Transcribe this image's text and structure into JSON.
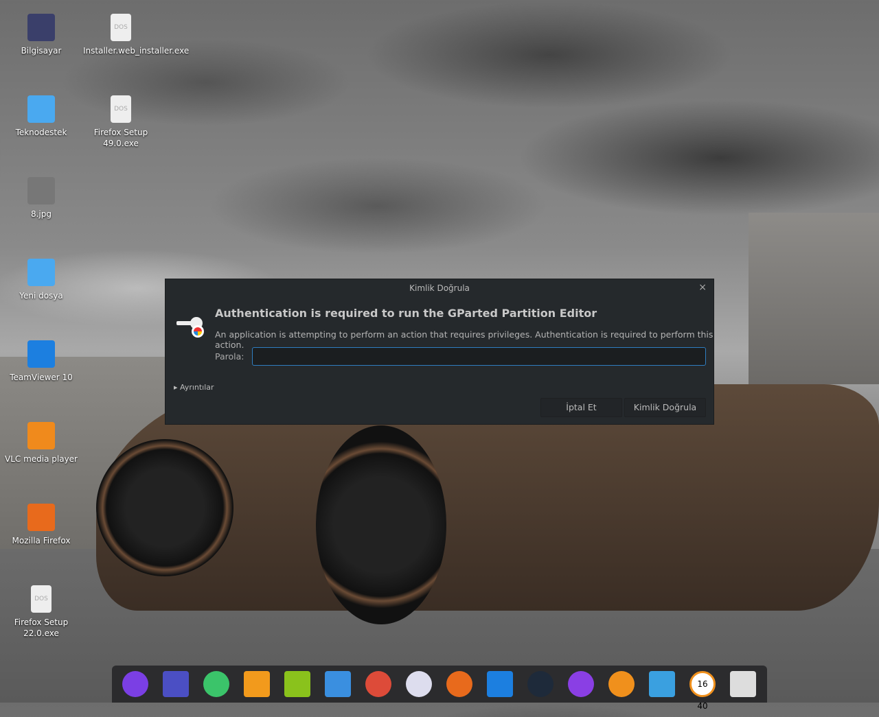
{
  "desktop_icons": [
    {
      "label": "Bilgisayar",
      "color": "#3a3f6a"
    },
    {
      "label": "Teknodestek",
      "color": "#4aa9f0"
    },
    {
      "label": "8.jpg",
      "color": "#777"
    },
    {
      "label": "Yeni dosya",
      "color": "#4aa9f0"
    },
    {
      "label": "TeamViewer 10",
      "color": "#1c7fe0"
    },
    {
      "label": "VLC media player",
      "color": "#f08a1c"
    },
    {
      "label": "Mozilla Firefox",
      "color": "#e86a1c"
    },
    {
      "label": "Firefox Setup 22.0.exe",
      "color": "#eee"
    },
    {
      "label": "Installer.web_installer.exe",
      "color": "#eee"
    },
    {
      "label": "Firefox Setup 49.0.exe",
      "color": "#eee"
    }
  ],
  "file_badge": "DOS",
  "dialog": {
    "title": "Kimlik Doğrula",
    "close": "×",
    "heading": "Authentication is required to run the GParted Partition Editor",
    "message": "An application is attempting to perform an action that requires privileges. Authentication is required to perform this action.",
    "password_label": "Parola:",
    "password_value": "",
    "details": "Ayrıntılar",
    "cancel": "İptal Et",
    "confirm": "Kimlik Doğrula"
  },
  "dock": [
    {
      "name": "launcher",
      "color": "#7b3fe4"
    },
    {
      "name": "screenshot",
      "color": "#4b4fc4"
    },
    {
      "name": "deepin-store",
      "color": "#3bc46a"
    },
    {
      "name": "app-store",
      "color": "#f29a1c"
    },
    {
      "name": "music",
      "color": "#8ac21c"
    },
    {
      "name": "video",
      "color": "#3a8fe0"
    },
    {
      "name": "chrome",
      "color": "#dd4b39"
    },
    {
      "name": "settings",
      "color": "#dde"
    },
    {
      "name": "firefox",
      "color": "#e86a1c"
    },
    {
      "name": "teamviewer",
      "color": "#1c7fe0"
    },
    {
      "name": "system-monitor",
      "color": "#1e2a3a"
    },
    {
      "name": "shutdown",
      "color": "#8a3fe4"
    },
    {
      "name": "file-manager",
      "color": "#f0901c"
    },
    {
      "name": "screen-capture",
      "color": "#3aa0e0"
    },
    {
      "name": "clock",
      "color": "#fff"
    },
    {
      "name": "trash",
      "color": "#ddd"
    }
  ],
  "clock_text": "16 40"
}
